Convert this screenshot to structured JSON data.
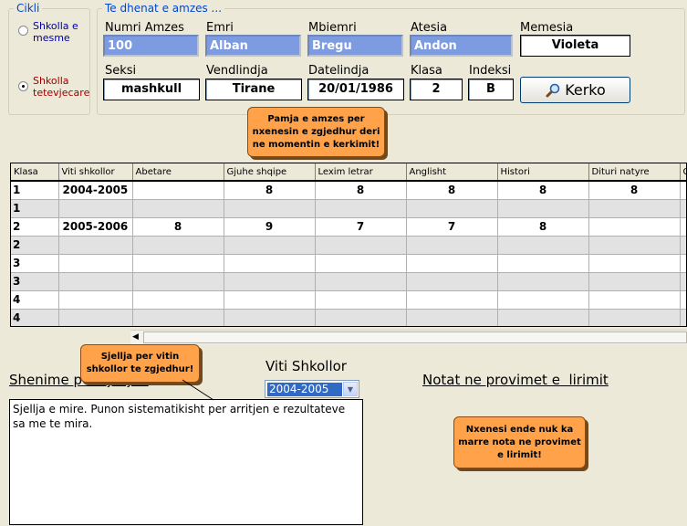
{
  "cikli": {
    "legend": "Cikli",
    "options": [
      {
        "label_lines": [
          "Shkolla e",
          "mesme"
        ],
        "checked": false,
        "color": "#0000A0"
      },
      {
        "label_lines": [
          "Shkolla",
          "tetevjecare"
        ],
        "checked": true,
        "color": "#A00000"
      }
    ]
  },
  "te_dhenat": {
    "legend": "Te dhenat e amzes ...",
    "labels": {
      "numri_amzes": "Numri Amzes",
      "emri": "Emri",
      "mbiemri": "Mbiemri",
      "atesia": "Atesia",
      "memesia": "Memesia",
      "seksi": "Seksi",
      "vendlindja": "Vendlindja",
      "datelindja": "Datelindja",
      "klasa": "Klasa",
      "indeksi": "Indeksi"
    },
    "values": {
      "numri_amzes": "100",
      "emri": "Alban",
      "mbiemri": "Bregu",
      "atesia": "Andon",
      "memesia": "Violeta",
      "seksi": "mashkull",
      "vendlindja": "Tirane",
      "datelindja": "20/01/1986",
      "klasa": "2",
      "indeksi": "B"
    },
    "search_button": "Kerko"
  },
  "tooltips": {
    "top": [
      "Pamja e amzes per",
      "nxenesin e zgjedhur deri",
      "ne momentin e kerkimit!"
    ],
    "sjellja": [
      "Sjellja per vitin",
      "shkollor te zgjedhur!"
    ],
    "provime": [
      "Nxenesi ende nuk ka",
      "marre nota ne provimet",
      "e lirimit!"
    ]
  },
  "grades_table": {
    "columns": [
      "Klasa",
      "Viti shkollor",
      "Abetare",
      "Gjuhe shqipe",
      "Lexim letrar",
      "Anglisht",
      "Histori",
      "Dituri natyre",
      "G"
    ],
    "rows": [
      {
        "alt": false,
        "cells": [
          "1",
          "2004-2005",
          "",
          "8",
          "8",
          "8",
          "8",
          "8",
          ""
        ]
      },
      {
        "alt": true,
        "cells": [
          "1",
          "",
          "",
          "",
          "",
          "",
          "",
          "",
          ""
        ]
      },
      {
        "alt": false,
        "cells": [
          "2",
          "2005-2006",
          "8",
          "9",
          "7",
          "7",
          "8",
          "",
          ""
        ]
      },
      {
        "alt": true,
        "cells": [
          "2",
          "",
          "",
          "",
          "",
          "",
          "",
          "",
          ""
        ]
      },
      {
        "alt": false,
        "cells": [
          "3",
          "",
          "",
          "",
          "",
          "",
          "",
          "",
          ""
        ]
      },
      {
        "alt": true,
        "cells": [
          "3",
          "",
          "",
          "",
          "",
          "",
          "",
          "",
          ""
        ]
      },
      {
        "alt": false,
        "cells": [
          "4",
          "",
          "",
          "",
          "",
          "",
          "",
          "",
          ""
        ]
      },
      {
        "alt": true,
        "cells": [
          "4",
          "",
          "",
          "",
          "",
          "",
          "",
          "",
          ""
        ]
      }
    ]
  },
  "sjellja": {
    "heading": "Shenime per sjelljen",
    "text": "Sjellja e mire. Punon sistematikisht per arritjen e rezultateve sa me te mira."
  },
  "viti_shkollor": {
    "label": "Viti Shkollor",
    "selected": "2004-2005"
  },
  "provimet": {
    "heading": "Notat ne provimet e  lirimit"
  }
}
